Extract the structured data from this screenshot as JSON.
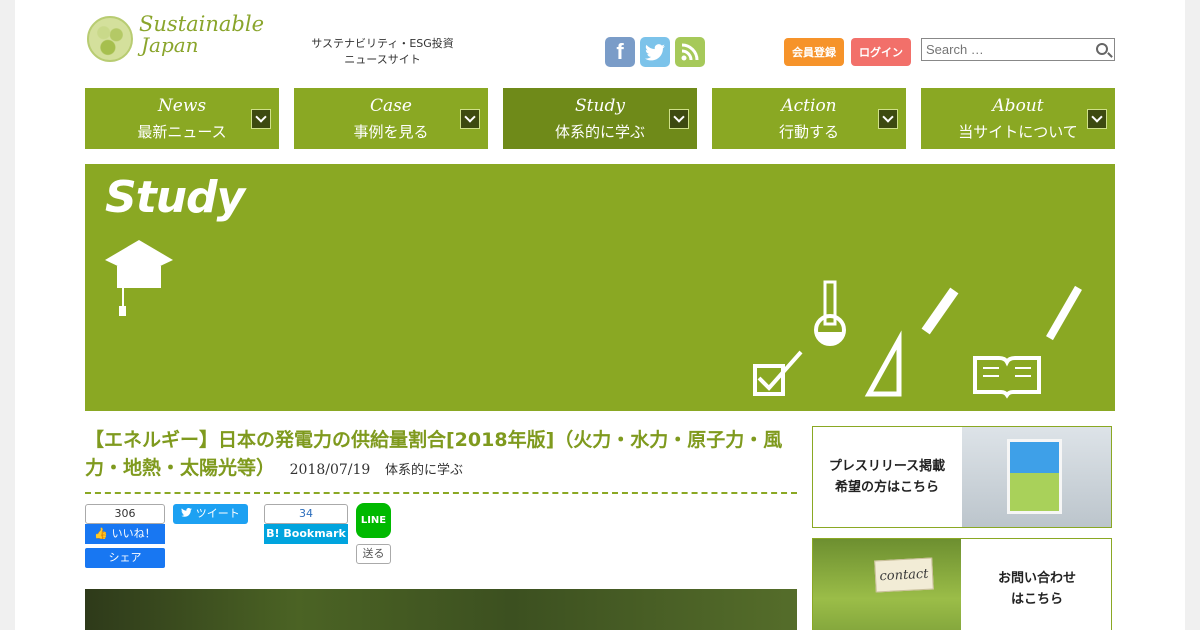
{
  "header": {
    "logo_line1": "Sustainable",
    "logo_line2": "Japan",
    "tagline_line1": "サステナビリティ・ESG投資",
    "tagline_line2": "ニュースサイト",
    "social": {
      "facebook": "f",
      "twitter": "t",
      "rss": "rss"
    },
    "register_label": "会員登録",
    "login_label": "ログイン",
    "search_placeholder": "Search …"
  },
  "nav": [
    {
      "en": "News",
      "jp": "最新ニュース"
    },
    {
      "en": "Case",
      "jp": "事例を見る"
    },
    {
      "en": "Study",
      "jp": "体系的に学ぶ",
      "active": true
    },
    {
      "en": "Action",
      "jp": "行動する"
    },
    {
      "en": "About",
      "jp": "当サイトについて"
    }
  ],
  "banner": {
    "title": "Study"
  },
  "article": {
    "title": "【エネルギー】日本の発電力の供給量割合[2018年版]（火力・水力・原子力・風力・地熱・太陽光等）",
    "date": "2018/07/19",
    "category": "体系的に学ぶ"
  },
  "share": {
    "fb_count": "306",
    "fb_like": "いいね！",
    "fb_share": "シェア",
    "tweet": "ツイート",
    "hatena_count": "34",
    "hatena_label": "Bookmark",
    "line_label": "LINE",
    "line_send": "送る"
  },
  "sidebar": {
    "ad1_line1": "プレスリリース掲載",
    "ad1_line2": "希望の方はこちら",
    "ad2_sign": "contact",
    "ad2_line1": "お問い合わせ",
    "ad2_line2": "はこちら"
  },
  "colors": {
    "brand_green": "#8aa823",
    "active_green": "#6f8a19",
    "orange": "#f6932a",
    "red": "#f2706a"
  }
}
